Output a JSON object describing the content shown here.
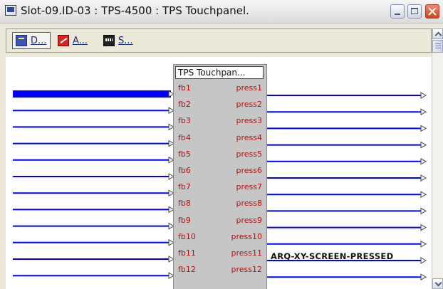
{
  "window": {
    "title": "Slot-09.ID-03 : TPS-4500 : TPS Touchpanel.",
    "icon": "application-window-icon",
    "controls": [
      "minimize-icon",
      "maximize-icon",
      "close-icon"
    ]
  },
  "toolbar": {
    "tabs": [
      {
        "label": "D...",
        "icon": "detail-view-icon",
        "active": true
      },
      {
        "label": "A...",
        "icon": "analog-view-icon",
        "active": false
      },
      {
        "label": "S...",
        "icon": "serial-view-icon",
        "active": false
      }
    ]
  },
  "symbol": {
    "title": "TPS Touchpan...",
    "inputs": [
      "fb1",
      "fb2",
      "fb3",
      "fb4",
      "fb5",
      "fb6",
      "fb7",
      "fb8",
      "fb9",
      "fb10",
      "fb11",
      "fb12"
    ],
    "outputs": [
      "press1",
      "press2",
      "press3",
      "press4",
      "press5",
      "press6",
      "press7",
      "press8",
      "press9",
      "press10",
      "press11",
      "press12"
    ],
    "selected_input_index": 0
  },
  "signals": {
    "press11": "ARQ-XY-SCREEN-PRESSED"
  },
  "colors": {
    "wire": "#0000ff",
    "pin_text": "#b01010",
    "selected_wire": "#0000ff"
  }
}
